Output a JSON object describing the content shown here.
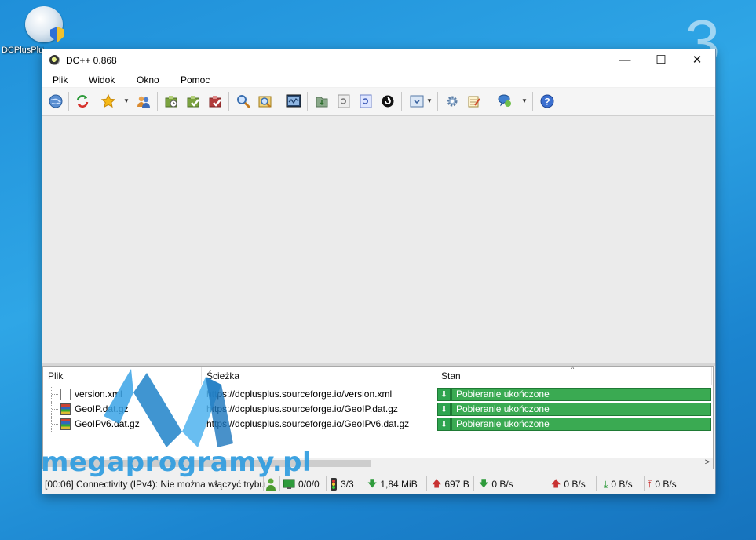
{
  "desktop": {
    "icon_label": "DCPlusPlus",
    "corner_number": "3"
  },
  "window": {
    "title": "DC++ 0.868",
    "controls": {
      "minimize": "—",
      "maximize": "☐",
      "close": "✕"
    }
  },
  "menu": [
    "Plik",
    "Widok",
    "Okno",
    "Pomoc"
  ],
  "toolbar": {
    "icons": [
      "globe-icon",
      "refresh-icon",
      "favorites-star-icon",
      "users-icon",
      "download-queue-icon",
      "finished-downloads-icon",
      "finished-uploads-icon",
      "search-icon",
      "adl-search-icon",
      "system-log-icon",
      "notepad-icon",
      "recheck-icon",
      "match-queue-icon",
      "away-icon",
      "open-filelist-icon",
      "settings-icon",
      "notepad-edit-icon",
      "connect-hubs-icon",
      "help-icon"
    ]
  },
  "queue": {
    "columns": [
      "Plik",
      "Ścieżka",
      "Stan"
    ],
    "rows": [
      {
        "name": "version.xml",
        "path": "https://dcplusplus.sourceforge.io/version.xml",
        "status": "Pobieranie ukończone"
      },
      {
        "name": "GeoIP.dat.gz",
        "path": "https://dcplusplus.sourceforge.io/GeoIP.dat.gz",
        "status": "Pobieranie ukończone"
      },
      {
        "name": "GeoIPv6.dat.gz",
        "path": "https://dcplusplus.sourceforge.io/GeoIPv6.dat.gz",
        "status": "Pobieranie ukończone"
      }
    ]
  },
  "statusbar": {
    "message": "[00:06] Connectivity (IPv4): Nie można włączyć trybu",
    "hubs": "0/0/0",
    "slots": "3/3",
    "downloaded": "1,84 MiB",
    "uploaded": "697 B",
    "down_speed": "0 B/s",
    "up_speed": "0 B/s",
    "down_limit": "0 B/s",
    "up_limit": "0 B/s"
  },
  "watermark": {
    "text": "megaprogramy.pl"
  },
  "colors": {
    "status_green": "#3aaa52",
    "desktop_blue": "#2fa6e6",
    "watermark_blue": "#2f9de0"
  }
}
